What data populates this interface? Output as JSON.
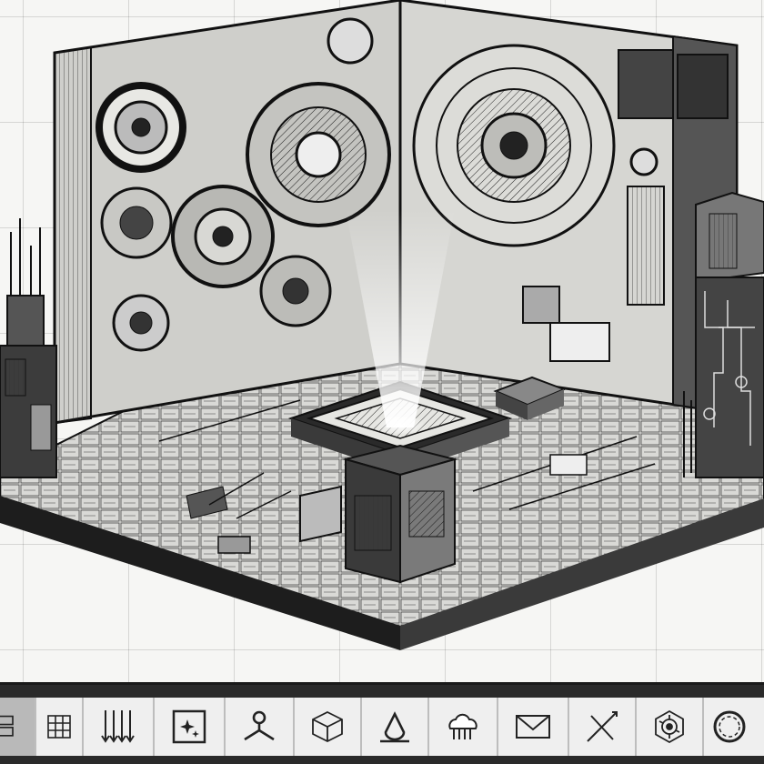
{
  "colors": {
    "canvas_background": "#f6f6f4",
    "toolbar_background": "#2a2a2a",
    "tool_background": "#efefef",
    "active_tool": "#b9b9b9",
    "ink": "#1a1a1a"
  },
  "toolbar": {
    "active_index": 0,
    "tools": [
      {
        "icon": "layers-icon"
      },
      {
        "icon": "grid-icon"
      },
      {
        "icon": "arrows-down-icon"
      },
      {
        "icon": "frame-sparkle-icon"
      },
      {
        "icon": "node-branch-icon"
      },
      {
        "icon": "cube-icon"
      },
      {
        "icon": "delta-icon"
      },
      {
        "icon": "cloud-icon"
      },
      {
        "icon": "envelope-icon"
      },
      {
        "icon": "pen-cross-icon"
      },
      {
        "icon": "gear-hex-icon"
      },
      {
        "icon": "ring-icon"
      }
    ]
  }
}
